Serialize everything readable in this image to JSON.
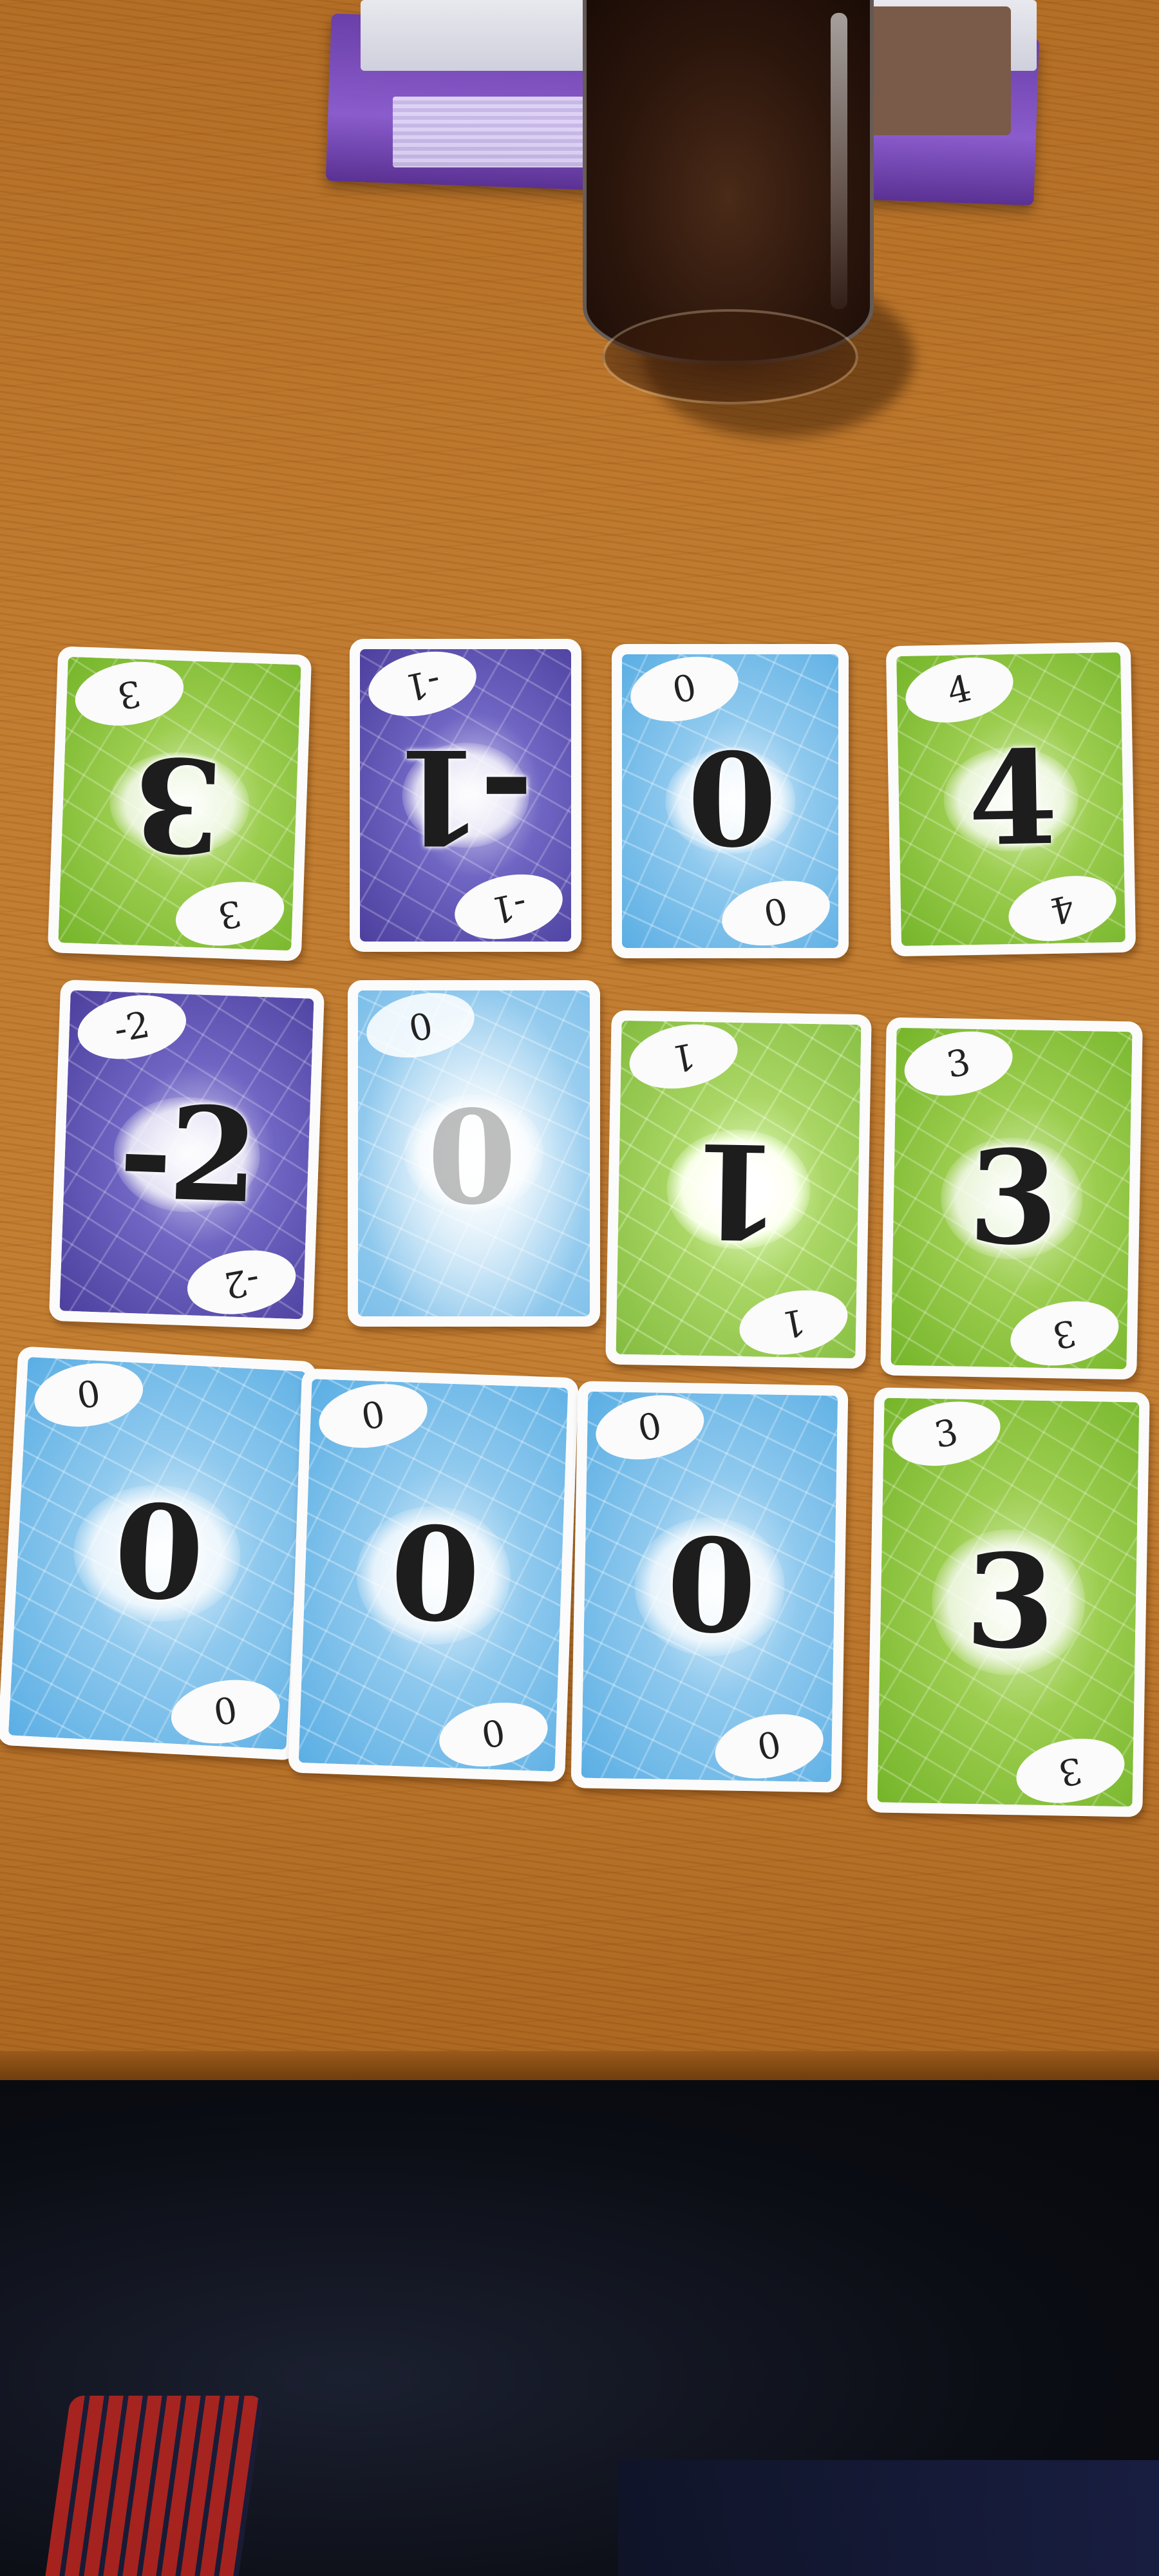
{
  "scene": {
    "colors": {
      "table": "#bf7a2e",
      "green": "#8cc63f",
      "blue": "#6bb8ea",
      "purple": "#4f43a3"
    },
    "cards": [
      {
        "value": "3",
        "color": "green",
        "upside_down": true,
        "corner_top": "3",
        "corner_bottom": "3"
      },
      {
        "value": "-1",
        "color": "purple",
        "upside_down": true,
        "corner_top": "-1",
        "corner_bottom": "-1"
      },
      {
        "value": "0",
        "color": "blue",
        "upside_down": false,
        "corner_top": "0",
        "corner_bottom": "0"
      },
      {
        "value": "4",
        "color": "green",
        "upside_down": false,
        "corner_top": "4",
        "corner_bottom": "4"
      },
      {
        "value": "-2",
        "color": "purple",
        "upside_down": false,
        "corner_top": "-2",
        "corner_bottom": "-2"
      },
      {
        "value": "0",
        "color": "blue",
        "upside_down": true,
        "corner_top": "0",
        "corner_bottom": ""
      },
      {
        "value": "1",
        "color": "green",
        "upside_down": true,
        "corner_top": "1",
        "corner_bottom": "1"
      },
      {
        "value": "3",
        "color": "green",
        "upside_down": false,
        "corner_top": "3",
        "corner_bottom": "3"
      },
      {
        "value": "0",
        "color": "blue",
        "upside_down": false,
        "corner_top": "0",
        "corner_bottom": "0"
      },
      {
        "value": "0",
        "color": "blue",
        "upside_down": false,
        "corner_top": "0",
        "corner_bottom": "0"
      },
      {
        "value": "0",
        "color": "blue",
        "upside_down": false,
        "corner_top": "0",
        "corner_bottom": "0"
      },
      {
        "value": "3",
        "color": "green",
        "upside_down": false,
        "corner_top": "3",
        "corner_bottom": "3"
      }
    ]
  }
}
